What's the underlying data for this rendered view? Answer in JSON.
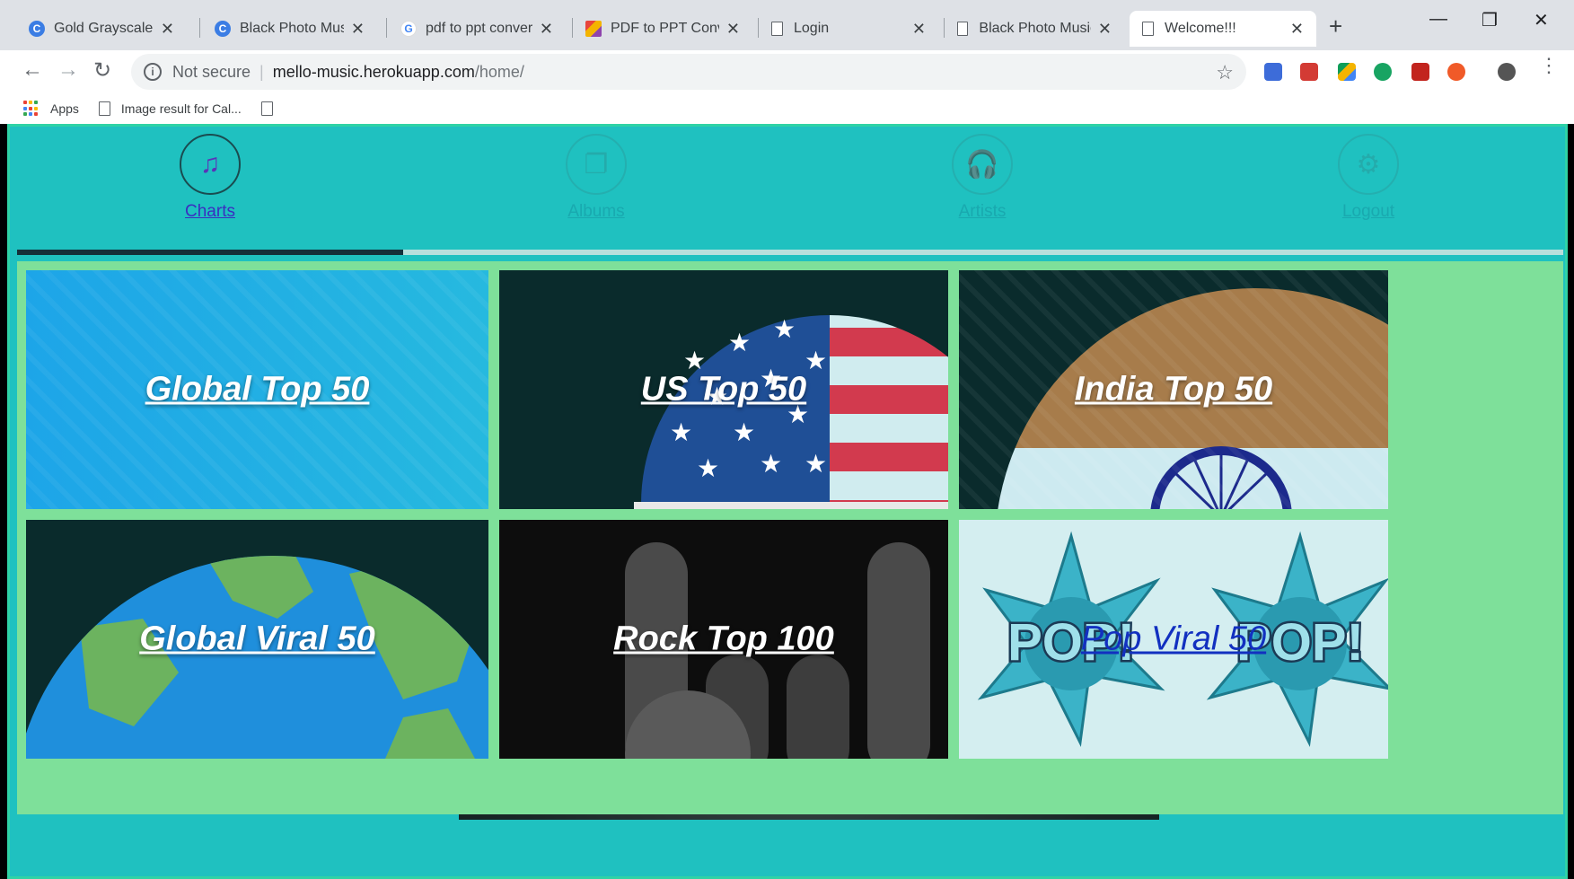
{
  "browser": {
    "tabs": [
      {
        "title": "Gold Grayscale Big",
        "favicon": "canva-icon",
        "color": "#3b7de4",
        "active": false
      },
      {
        "title": "Black Photo Music",
        "favicon": "canva-icon",
        "color": "#3b7de4",
        "active": false
      },
      {
        "title": "pdf to ppt convert",
        "favicon": "google-icon",
        "color": "#4285f4",
        "active": false
      },
      {
        "title": "PDF to PPT Conve",
        "favicon": "smallpdf-icon",
        "color": "#e8453c",
        "active": false
      },
      {
        "title": "Login",
        "favicon": "document-icon",
        "color": "#5f6368",
        "active": false
      },
      {
        "title": "Black Photo Music",
        "favicon": "document-icon",
        "color": "#5f6368",
        "active": false
      },
      {
        "title": "Welcome!!!",
        "favicon": "document-icon",
        "color": "#5f6368",
        "active": true
      }
    ],
    "address": {
      "security": "Not secure",
      "host": "mello-music.herokuapp.com",
      "path": "/home/"
    },
    "bookmarks": [
      {
        "label": "Apps",
        "icon": "apps-grid-icon"
      },
      {
        "label": "Image result for Cal...",
        "icon": "document-icon"
      },
      {
        "label": "",
        "icon": "document-icon"
      }
    ],
    "extensions": [
      "#3d6cd9",
      "#d33b34",
      "#f4b400",
      "#18a462",
      "#c2241e",
      "#f05a28"
    ]
  },
  "nav": {
    "items": [
      {
        "label": "Charts",
        "icon": "music-note-icon",
        "active": true
      },
      {
        "label": "Albums",
        "icon": "album-icon",
        "active": false
      },
      {
        "label": "Artists",
        "icon": "headphones-icon",
        "active": false
      },
      {
        "label": "Logout",
        "icon": "gears-icon",
        "active": false
      }
    ]
  },
  "tiles": [
    {
      "label": "Global Top 50"
    },
    {
      "label": "US Top 50"
    },
    {
      "label": "India Top 50"
    },
    {
      "label": "Global Viral 50"
    },
    {
      "label": "Rock Top 100"
    },
    {
      "label": "Pop Viral 50"
    }
  ],
  "colors": {
    "page_bg": "#1fc1c0",
    "grid_border": "#7ee09a",
    "nav_active": "#3a2ec0"
  }
}
